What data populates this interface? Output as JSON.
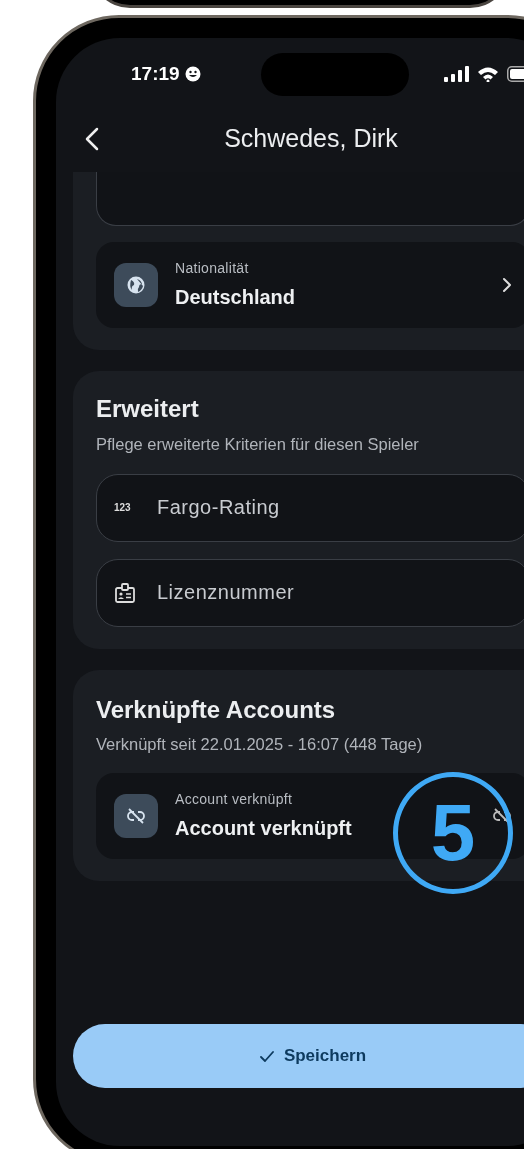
{
  "status_bar": {
    "time": "17:19"
  },
  "header": {
    "title": "Schwedes, Dirk"
  },
  "nationality": {
    "label": "Nationalität",
    "value": "Deutschland"
  },
  "extended": {
    "title": "Erweitert",
    "subtitle": "Pflege erweiterte Kriterien für diesen Spieler",
    "fields": [
      {
        "kind": "number",
        "icon_text": "123",
        "placeholder": "Fargo-Rating"
      },
      {
        "kind": "license",
        "placeholder": "Lizenznummer"
      }
    ]
  },
  "linked_accounts": {
    "title": "Verknüpfte Accounts",
    "subtitle": "Verknüpft seit 22.01.2025 - 16:07 (448 Tage)",
    "account": {
      "label": "Account verknüpft",
      "value": "Account verknüpft"
    }
  },
  "save_button": {
    "label": "Speichern"
  },
  "callout": {
    "number": "5"
  }
}
